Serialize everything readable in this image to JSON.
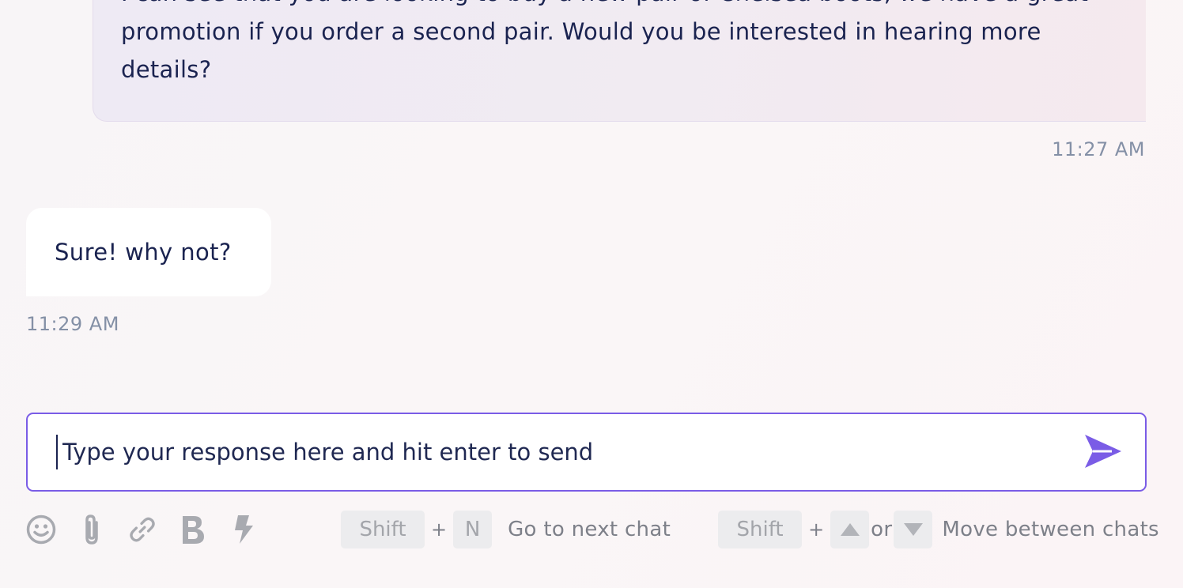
{
  "conversation": {
    "agent_message": {
      "text": "I can see that you are looking to buy a new pair of Chelsea boots, we have a great promotion if you order a second pair. Would you be interested in hearing more details?",
      "timestamp": "11:27 AM"
    },
    "customer_message": {
      "text": "Sure! why not?",
      "timestamp": "11:29 AM"
    }
  },
  "composer": {
    "placeholder": "Type your response here and hit enter to send",
    "value": "",
    "send_icon": "send-arrow-icon",
    "accent_color": "#7a5ce6"
  },
  "toolbar": {
    "icons": [
      "emoji-icon",
      "attachment-icon",
      "link-icon",
      "bold-icon",
      "lightning-icon"
    ]
  },
  "shortcuts": {
    "next_chat": {
      "key1": "Shift",
      "plus": "+",
      "key2": "N",
      "label": "Go to next chat"
    },
    "move_between": {
      "key1": "Shift",
      "plus": "+",
      "or": "or",
      "label": "Move between chats"
    }
  }
}
